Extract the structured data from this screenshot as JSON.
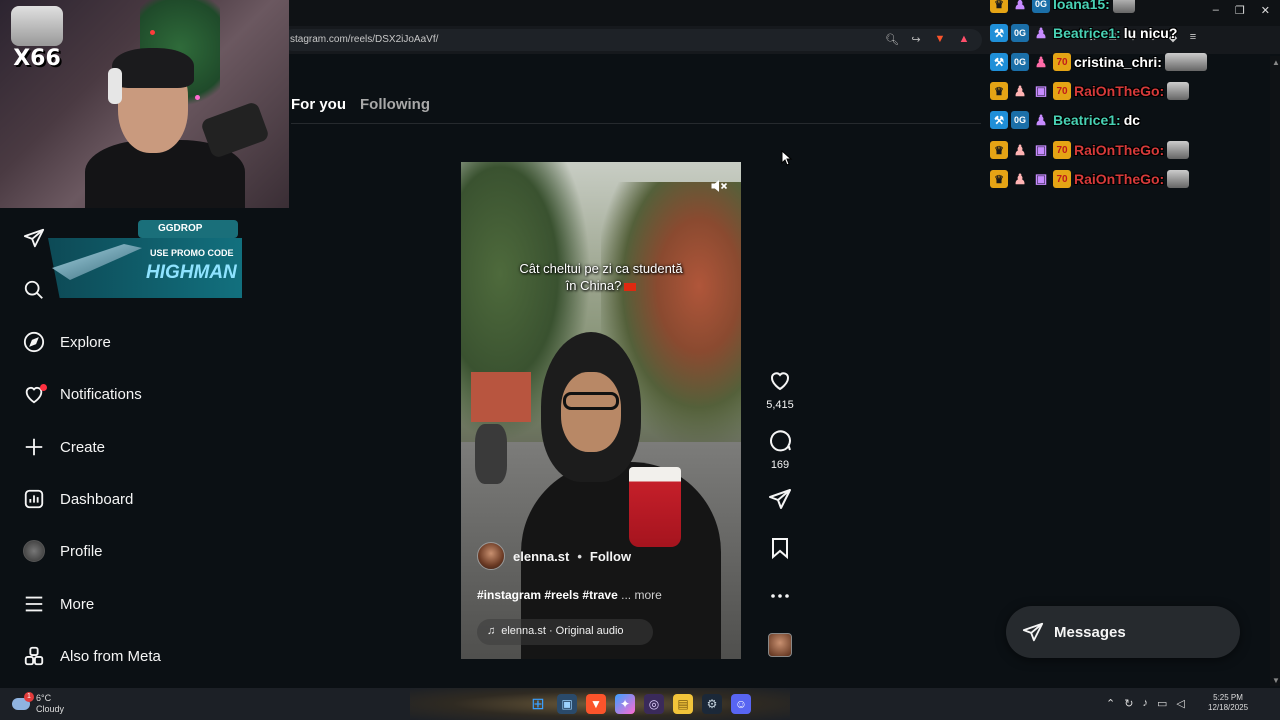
{
  "browser": {
    "url": "stagram.com/reels/DSX2iJoAaVf/",
    "window_controls": [
      "–",
      "❐",
      "✕"
    ]
  },
  "webcam": {
    "badge_label": "X66"
  },
  "promo_banner": {
    "brand": "GGDROP",
    "line1": "USE PROMO CODE",
    "code": "HIGHMAN"
  },
  "sidebar": {
    "items": [
      {
        "label": "Messages",
        "icon": "paper-plane-icon"
      },
      {
        "label": "Search",
        "icon": "search-icon"
      },
      {
        "label": "Explore",
        "icon": "compass-icon"
      },
      {
        "label": "Notifications",
        "icon": "heart-icon"
      },
      {
        "label": "Create",
        "icon": "plus-icon"
      },
      {
        "label": "Dashboard",
        "icon": "chart-icon"
      },
      {
        "label": "Profile",
        "icon": "avatar-icon"
      },
      {
        "label": "More",
        "icon": "menu-icon"
      },
      {
        "label": "Also from Meta",
        "icon": "apps-icon"
      }
    ]
  },
  "feed": {
    "tabs": [
      {
        "label": "For you",
        "active": true
      },
      {
        "label": "Following",
        "active": false
      }
    ]
  },
  "reel": {
    "caption_line1": "Cât cheltui pe zi ca studentă",
    "caption_line2": "în China?",
    "username": "elenna.st",
    "separator": "•",
    "follow_label": "Follow",
    "tags": "#instagram #reels #trave",
    "more_label": "... more",
    "audio_label": "elenna.st · Original audio"
  },
  "actions": {
    "likes": "5,415",
    "comments": "169"
  },
  "chat": {
    "lines": [
      {
        "name": "Ioana15:",
        "message": "",
        "name_color": "#48d1b4"
      },
      {
        "name": "Beatrice1:",
        "message": "lu nicu?",
        "name_color": "#48d1b4"
      },
      {
        "name": "cristina_chri:",
        "message": "",
        "name_color": "#ffffff"
      },
      {
        "name": "RaiOnTheGo:",
        "message": "",
        "name_color": "#d63a3a"
      },
      {
        "name": "Beatrice1:",
        "message": "dc",
        "name_color": "#48d1b4"
      },
      {
        "name": "RaiOnTheGo:",
        "message": "",
        "name_color": "#d63a3a"
      },
      {
        "name": "RaiOnTheGo:",
        "message": "",
        "name_color": "#d63a3a"
      }
    ],
    "badges": {
      "rank": "0G",
      "num": "70"
    }
  },
  "messages_pill": {
    "label": "Messages"
  },
  "taskbar": {
    "temperature": "6°C",
    "condition": "Cloudy",
    "weather_badge": "1",
    "time": "5:25 PM",
    "date": "12/18/2025"
  },
  "colors": {
    "background": "#0b1014",
    "notification_dot": "#ff3040",
    "chat_teal": "#48d1b4",
    "chat_red": "#d63a3a"
  }
}
